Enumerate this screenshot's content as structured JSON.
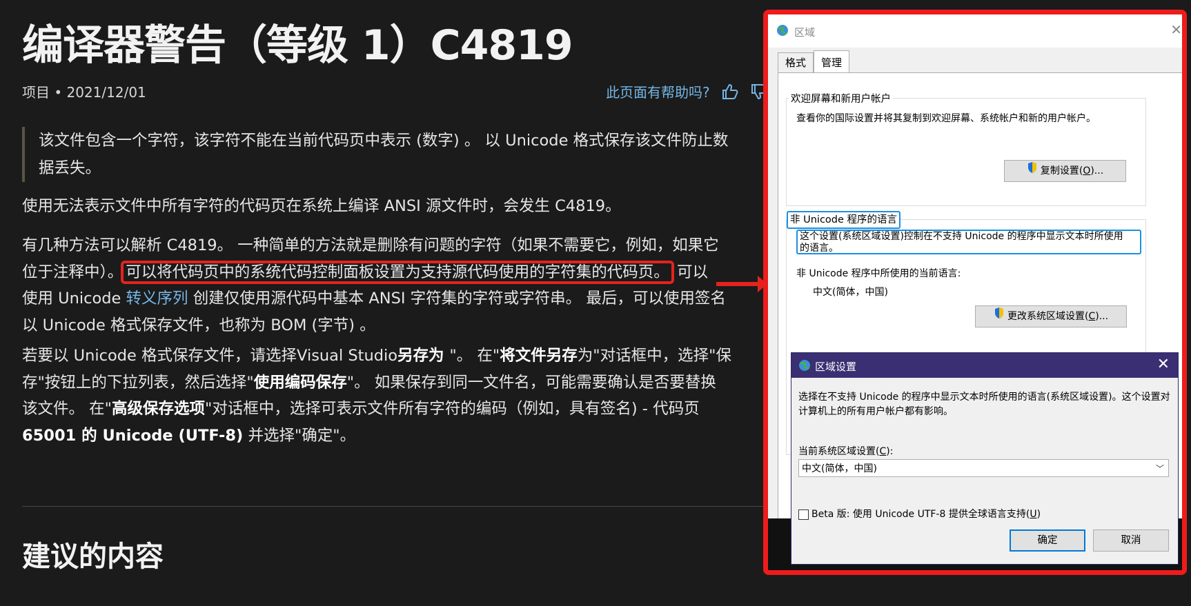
{
  "article": {
    "title": "编译器警告（等级 1）C4819",
    "meta": "项目 • 2021/12/01",
    "helpful": "此页面有帮助吗?",
    "quote": "该文件包含一个字符，该字符不能在当前代码页中表示 (数字) 。 以 Unicode 格式保存该文件防止数据丢失。",
    "p1": "使用无法表示文件中所有字符的代码页在系统上编译 ANSI 源文件时，会发生 C4819。",
    "p2a": "有几种方法可以解析 C4819。 一种简单的方法就是删除有问题的字符（如果不需要它，例如，如果它",
    "p2b": "位于注释中）。",
    "p2_highlight": "可以将代码页中的系统代码控制面板设置为支持源代码使用的字符集的代码页。",
    "p2c": "可以",
    "p2d": "使用 Unicode ",
    "p2_link": "转义序列",
    "p2e": " 创建仅使用源代码中基本 ANSI 字符集的字符或字符串。 最后，可以使用签名",
    "p2f": "以 Unicode 格式保存文件，也称为 BOM (字节) 。",
    "p3a": "若要以 Unicode 格式保存文件，请选择Visual Studio",
    "p3_b1": "另存为 ",
    "p3b": "\"。 在\"",
    "p3_b2": "将文件另存",
    "p3c": "为\"对话框中，选择\"保",
    "p3d": "存\"按钮上的下拉列表，然后选择\"",
    "p3_b3": "使用编码保存",
    "p3e": "\"。 如果保存到同一文件名，可能需要确认是否要替换",
    "p3f": "该文件。 在\"",
    "p3_b4": "高级保存选项",
    "p3g": "\"对话框中，选择可表示文件所有字符的编码（例如，具有签名) - 代码页",
    "p3_b5": "65001 的 Unicode (UTF-8)",
    "p3h": "并选择\"确定\"。",
    "section_heading": "建议的内容"
  },
  "region_dialog": {
    "title": "区域",
    "tabs": [
      "格式",
      "管理"
    ],
    "welcome_group": {
      "label": "欢迎屏幕和新用户帐户",
      "text": "查看你的国际设置并将其复制到欢迎屏幕、系统帐户和新的用户帐户。",
      "button": "复制设置(",
      "button_key": "O",
      "button_tail": ")..."
    },
    "nonunicode_group": {
      "label": "非 Unicode 程序的语言",
      "text_line1": "这个设置(系统区域设置)控制在不支持 Unicode 的程序中显示文本时所使用",
      "text_line2": "的语言。",
      "current_label": "非 Unicode 程序中所使用的当前语言:",
      "current_value": "中文(简体，中国)",
      "button": "更改系统区域设置(",
      "button_key": "C",
      "button_tail": ")..."
    }
  },
  "locale_dialog": {
    "title": "区域设置",
    "description": "选择在不支持 Unicode 的程序中显示文本时所使用的语言(系统区域设置)。这个设置对计算机上的所有用户帐户都有影响。",
    "select_label": "当前系统区域设置(",
    "select_label_key": "C",
    "select_label_tail": "):",
    "select_value": "中文(简体，中国)",
    "beta_label": "Beta 版: 使用 Unicode UTF-8 提供全球语言支持(",
    "beta_key": "U",
    "beta_tail": ")",
    "ok": "确定",
    "cancel": "取消"
  },
  "colors": {
    "background": "#1b1b1b",
    "link": "#75b6e7",
    "highlight_red": "#e5231d",
    "focus_blue": "#1a8fe3",
    "locale_titlebar": "#3a2f72"
  }
}
